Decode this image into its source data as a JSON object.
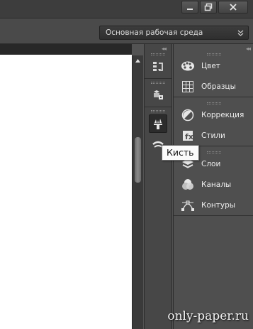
{
  "window": {
    "buttons": [
      {
        "name": "minimize",
        "icon": "minimize-icon"
      },
      {
        "name": "restore",
        "icon": "restore-icon"
      },
      {
        "name": "close",
        "icon": "close-icon"
      }
    ]
  },
  "options_bar": {
    "workspace_select": "Основная рабочая среда"
  },
  "dock": {
    "groups": [
      {
        "icons": [
          "history-icon"
        ]
      },
      {
        "icons": [
          "properties-icon"
        ]
      },
      {
        "icons": [
          "brush-icon",
          "brush-presets-icon"
        ]
      }
    ],
    "active_icon": "brush-icon"
  },
  "tooltip": {
    "text": "Кисть"
  },
  "panels": {
    "groups": [
      {
        "items": [
          {
            "label": "Цвет",
            "icon": "color-palette-icon"
          },
          {
            "label": "Образцы",
            "icon": "swatches-grid-icon"
          }
        ]
      },
      {
        "items": [
          {
            "label": "Коррекция",
            "icon": "adjustments-icon"
          },
          {
            "label": "Стили",
            "icon": "styles-icon"
          }
        ]
      },
      {
        "items": [
          {
            "label": "Слои",
            "icon": "layers-icon"
          },
          {
            "label": "Каналы",
            "icon": "channels-icon"
          },
          {
            "label": "Контуры",
            "icon": "paths-icon"
          }
        ]
      }
    ]
  },
  "watermark": "only-paper.ru",
  "colors": {
    "chrome": "#3d3d3d",
    "panel_bg": "#4f4f4f",
    "dock_bg": "#474747",
    "canvas": "#ffffff"
  }
}
